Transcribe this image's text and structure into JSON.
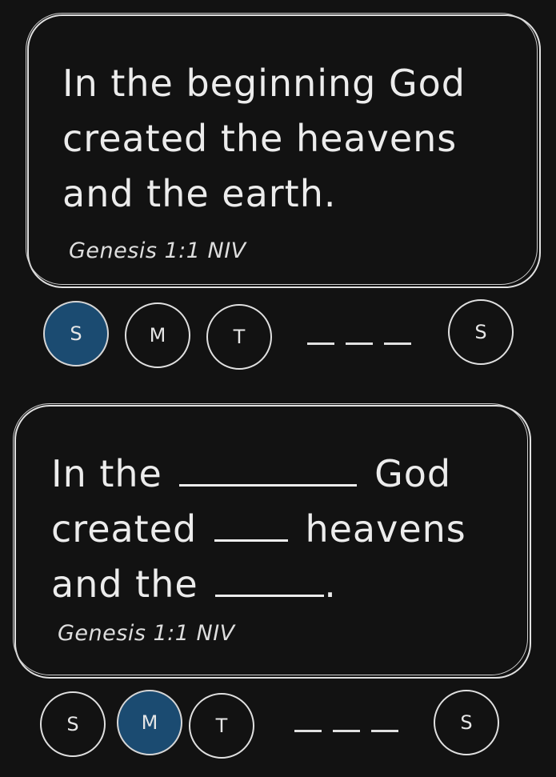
{
  "cards": [
    {
      "lines": [
        "In the beginning God",
        "created the heavens",
        "and the earth."
      ],
      "reference": "Genesis 1:1 NIV",
      "week": {
        "days": [
          {
            "label": "S",
            "active": true
          },
          {
            "label": "M",
            "active": false
          },
          {
            "label": "T",
            "active": false
          }
        ],
        "last": {
          "label": "S",
          "active": false
        }
      }
    },
    {
      "line1": {
        "start": "In the",
        "end": "God"
      },
      "line2": {
        "start": "created",
        "end": "heavens"
      },
      "line3": {
        "start": "and the",
        "end": "."
      },
      "reference": "Genesis 1:1 NIV",
      "week": {
        "days": [
          {
            "label": "S",
            "active": false
          },
          {
            "label": "M",
            "active": true
          },
          {
            "label": "T",
            "active": false
          }
        ],
        "last": {
          "label": "S",
          "active": false
        }
      }
    }
  ],
  "colors": {
    "background": "#121212",
    "stroke": "#e0e0e0",
    "active_day": "#1b4b71"
  }
}
